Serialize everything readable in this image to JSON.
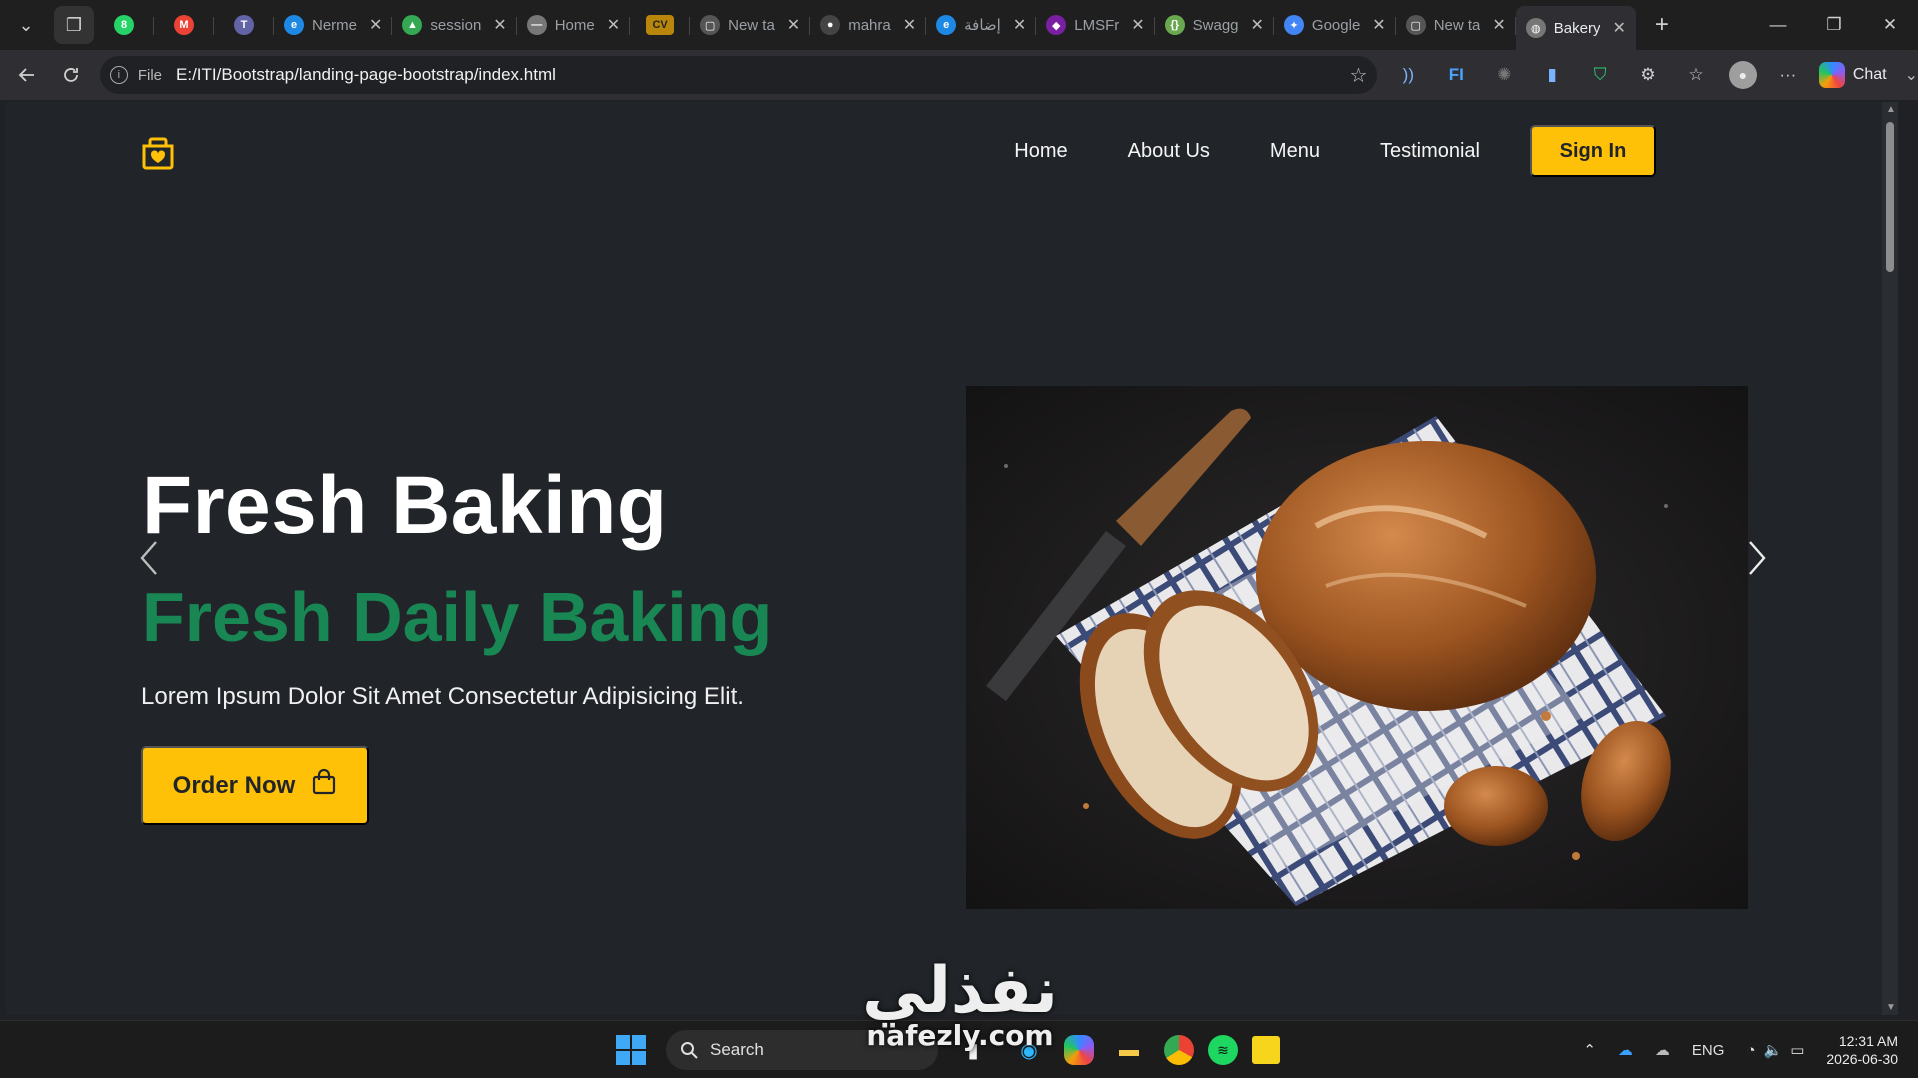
{
  "browser": {
    "tabs": [
      {
        "title": "",
        "favicon": "whatsapp-icon",
        "favicon_text": "8",
        "color": "#25d366",
        "pinned": true
      },
      {
        "title": "",
        "favicon": "gmail-icon",
        "favicon_text": "M",
        "color": "#ea4335",
        "pinned": true
      },
      {
        "title": "",
        "favicon": "teams-icon",
        "favicon_text": "T",
        "color": "#6264a7",
        "pinned": true
      },
      {
        "title": "Nerme",
        "favicon": "edge-icon",
        "favicon_text": "e",
        "color": "#1e88e5"
      },
      {
        "title": "session",
        "favicon": "drive-icon",
        "favicon_text": "▲",
        "color": "#34a853"
      },
      {
        "title": "Home",
        "favicon": "dash-icon",
        "favicon_text": "—",
        "color": "#777777"
      },
      {
        "title": "",
        "favicon": "cv-icon",
        "favicon_text": "CV",
        "color": "#b8860b",
        "pinned": true
      },
      {
        "title": "New ta",
        "favicon": "new-tab-icon",
        "favicon_text": "▢",
        "color": "#555555"
      },
      {
        "title": "mahra",
        "favicon": "github-icon",
        "favicon_text": "●",
        "color": "#444444"
      },
      {
        "title": "إضافة",
        "favicon": "edge-icon",
        "favicon_text": "e",
        "color": "#1e88e5"
      },
      {
        "title": "LMSFr",
        "favicon": "lms-icon",
        "favicon_text": "◆",
        "color": "#7b1fa2"
      },
      {
        "title": "Swagg",
        "favicon": "swagger-icon",
        "favicon_text": "{}",
        "color": "#6aa84f"
      },
      {
        "title": "Google",
        "favicon": "gemini-icon",
        "favicon_text": "✦",
        "color": "#4285f4"
      },
      {
        "title": "New ta",
        "favicon": "new-tab-icon",
        "favicon_text": "▢",
        "color": "#555555"
      },
      {
        "title": "Bakery",
        "favicon": "globe-icon",
        "favicon_text": "◍",
        "color": "#777777",
        "active": true
      }
    ],
    "address": {
      "scheme": "File",
      "url": "E:/ITI/Bootstrap/landing-page-bootstrap/index.html"
    },
    "chat_label": "Chat"
  },
  "site": {
    "nav": {
      "links": [
        "Home",
        "About Us",
        "Menu",
        "Testimonial"
      ],
      "signin_label": "Sign In"
    },
    "hero": {
      "title": "Fresh Baking",
      "subtitle": "Fresh Daily Baking",
      "text": "Lorem Ipsum Dolor Sit Amet Consectetur Adipisicing Elit.",
      "cta_label": "Order Now"
    },
    "colors": {
      "accent": "#ffc107",
      "subtitle": "#198754",
      "background": "#212529"
    }
  },
  "watermark": {
    "arabic": "نفذلي",
    "latin": "nafezly.com"
  },
  "taskbar": {
    "search_label": "Search",
    "language": "ENG",
    "time": "12:31 AM",
    "date": "2026-06-30"
  }
}
